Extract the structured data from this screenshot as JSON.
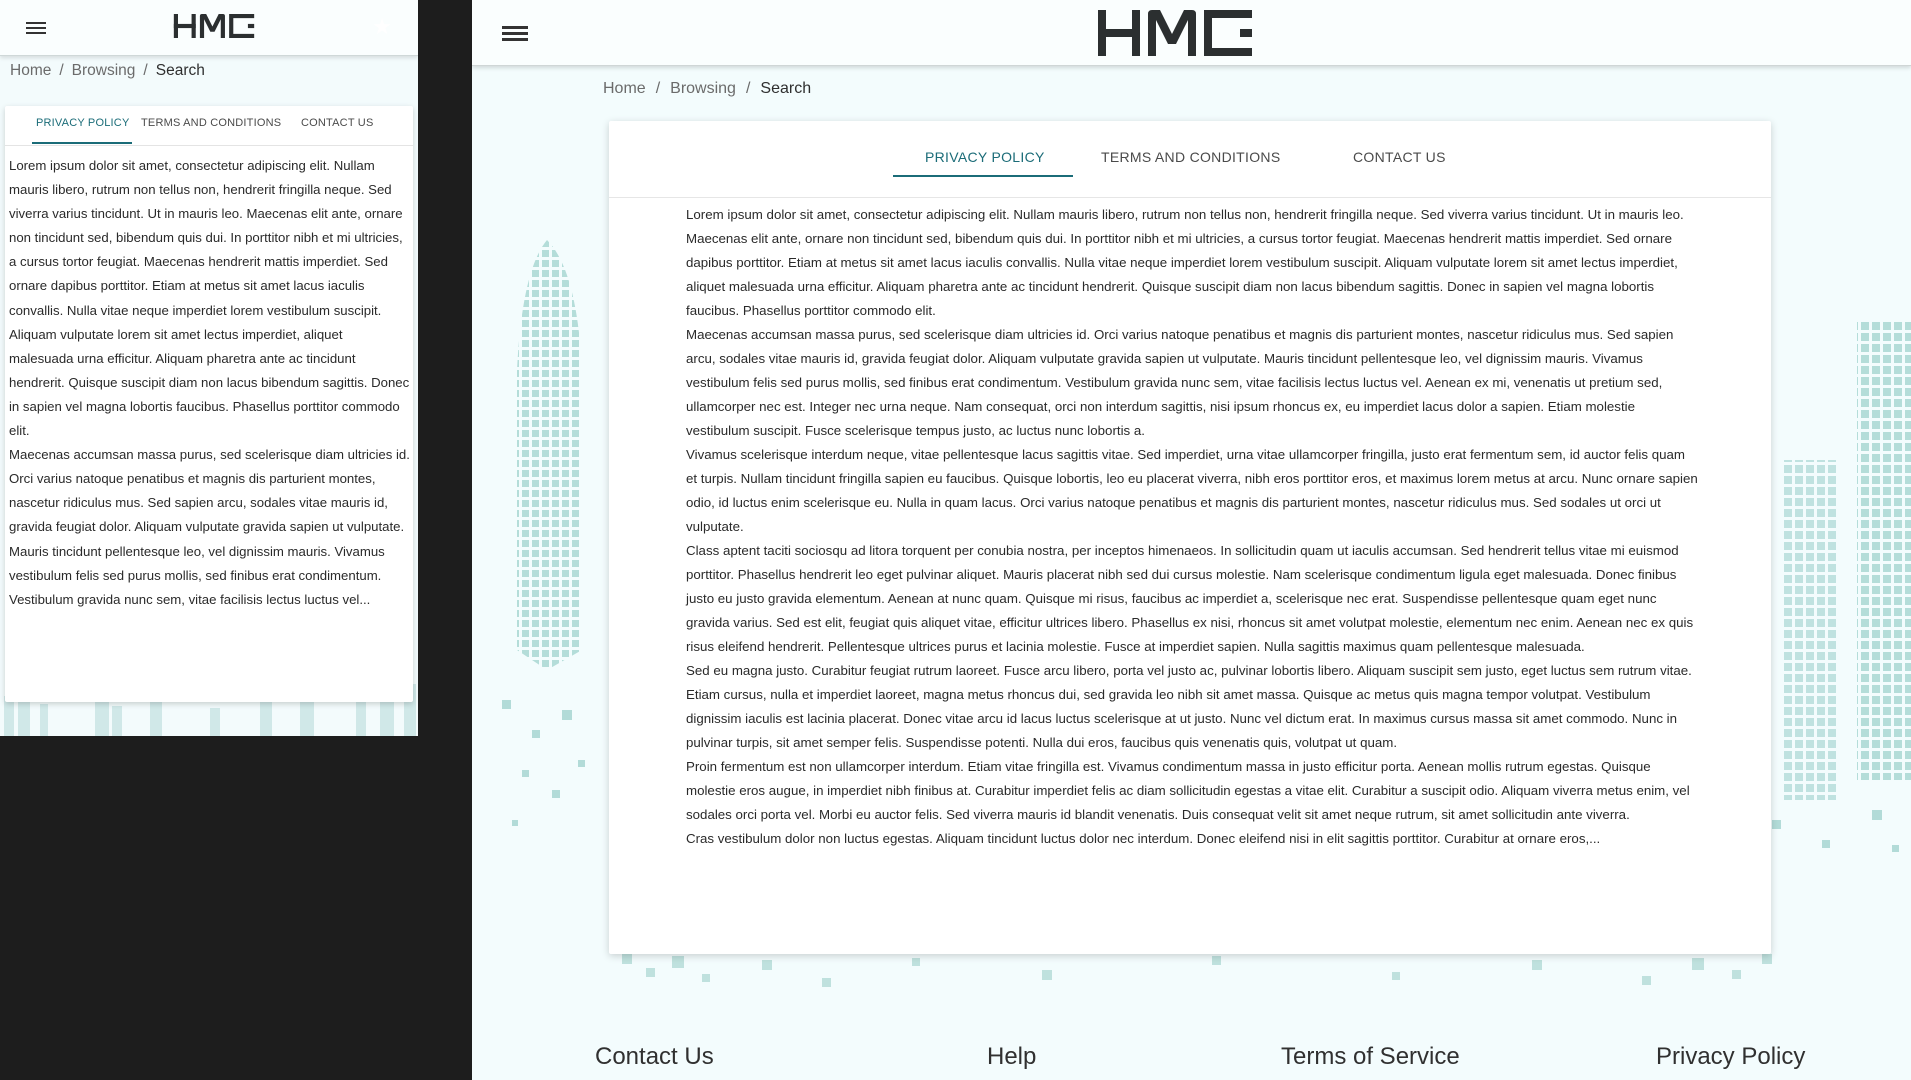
{
  "mobile": {
    "logo_text": "HME",
    "breadcrumb": {
      "home": "Home",
      "browsing": "Browsing",
      "current": "Search",
      "sep": "/"
    },
    "tabs": [
      "PRIVACY POLICY",
      "TERMS AND CONDITIONS",
      "CONTACT US"
    ],
    "paragraphs": [
      "Lorem ipsum dolor sit amet, consectetur adipiscing elit. Nullam mauris libero, rutrum non tellus non, hendrerit fringilla neque. Sed viverra varius tincidunt. Ut in mauris leo. Maecenas elit ante, ornare non tincidunt sed, bibendum quis dui. In porttitor nibh et mi ultricies, a cursus tortor feugiat. Maecenas hendrerit mattis imperdiet. Sed ornare dapibus porttitor. Etiam at metus sit amet lacus iaculis convallis. Nulla vitae neque imperdiet lorem vestibulum suscipit. Aliquam vulputate lorem sit amet lectus imperdiet, aliquet malesuada urna efficitur. Aliquam pharetra ante ac tincidunt hendrerit. Quisque suscipit diam non lacus bibendum sagittis. Donec in sapien vel magna lobortis faucibus. Phasellus porttitor commodo elit.",
      "Maecenas accumsan massa purus, sed scelerisque diam ultricies id. Orci varius natoque penatibus et magnis dis parturient montes, nascetur ridiculus mus. Sed sapien arcu, sodales vitae mauris id, gravida feugiat dolor. Aliquam vulputate gravida sapien ut vulputate. Mauris tincidunt pellentesque leo, vel dignissim mauris. Vivamus vestibulum felis sed purus mollis, sed finibus erat condimentum.",
      "Vestibulum gravida nunc sem, vitae facilisis lectus luctus vel..."
    ]
  },
  "desktop": {
    "logo_text": "HME",
    "breadcrumb": {
      "home": "Home",
      "browsing": "Browsing",
      "current": "Search",
      "sep": "/"
    },
    "tabs": [
      "PRIVACY POLICY",
      "TERMS AND CONDITIONS",
      "CONTACT US"
    ],
    "paragraphs": [
      "Lorem ipsum dolor sit amet, consectetur adipiscing elit. Nullam mauris libero, rutrum non tellus non, hendrerit fringilla neque. Sed viverra varius tincidunt. Ut in mauris leo. Maecenas elit ante, ornare non tincidunt sed, bibendum quis dui. In porttitor nibh et mi ultricies, a cursus tortor feugiat. Maecenas hendrerit mattis imperdiet. Sed ornare dapibus porttitor. Etiam at metus sit amet lacus iaculis convallis. Nulla vitae neque imperdiet lorem vestibulum suscipit. Aliquam vulputate lorem sit amet lectus imperdiet, aliquet malesuada urna efficitur. Aliquam pharetra ante ac tincidunt hendrerit. Quisque suscipit diam non lacus bibendum sagittis. Donec in sapien vel magna lobortis faucibus. Phasellus porttitor commodo elit.",
      "Maecenas accumsan massa purus, sed scelerisque diam ultricies id. Orci varius natoque penatibus et magnis dis parturient montes, nascetur ridiculus mus. Sed sapien arcu, sodales vitae mauris id, gravida feugiat dolor. Aliquam vulputate gravida sapien ut vulputate. Mauris tincidunt pellentesque leo, vel dignissim mauris. Vivamus vestibulum felis sed purus mollis, sed finibus erat condimentum. Vestibulum gravida nunc sem, vitae facilisis lectus luctus vel. Aenean ex mi, venenatis ut pretium sed, ullamcorper nec est. Integer nec urna neque. Nam consequat, orci non interdum sagittis, nisi ipsum rhoncus ex, eu imperdiet lacus dolor a sapien. Etiam molestie vestibulum suscipit. Fusce scelerisque tempus justo, ac luctus nunc lobortis a.",
      "Vivamus scelerisque interdum neque, vitae pellentesque lacus sagittis vitae. Sed imperdiet, urna vitae ullamcorper fringilla, justo erat fermentum sem, id auctor felis quam et turpis. Nullam tincidunt fringilla sapien eu faucibus. Quisque lobortis, leo eu placerat viverra, nibh eros porttitor eros, et maximus lorem metus at arcu. Nunc ornare sapien odio, id luctus enim scelerisque eu. Nulla in quam lacus. Orci varius natoque penatibus et magnis dis parturient montes, nascetur ridiculus mus. Sed sodales ut orci ut vulputate.",
      "Class aptent taciti sociosqu ad litora torquent per conubia nostra, per inceptos himenaeos. In sollicitudin quam ut iaculis accumsan. Sed hendrerit tellus vitae mi euismod porttitor. Phasellus hendrerit leo eget pulvinar aliquet. Mauris placerat nibh sed dui cursus molestie. Nam scelerisque condimentum ligula eget malesuada. Donec finibus justo eu justo gravida elementum. Aenean at nunc quam. Quisque mi risus, faucibus ac imperdiet a, scelerisque nec erat. Suspendisse pellentesque quam eget nunc gravida varius. Sed est elit, feugiat quis aliquet vitae, efficitur ultrices libero. Phasellus ex nisi, rhoncus sit amet volutpat molestie, elementum nec enim. Aenean nec ex quis risus eleifend hendrerit. Pellentesque ultrices purus et lacinia molestie. Fusce at imperdiet sapien. Nulla sagittis maximus quam pellentesque malesuada.",
      "Sed eu magna justo. Curabitur feugiat rutrum laoreet. Fusce arcu libero, porta vel justo ac, pulvinar lobortis libero. Aliquam suscipit sem justo, eget luctus sem rutrum vitae. Etiam cursus, nulla et imperdiet laoreet, magna metus rhoncus dui, sed gravida leo nibh sit amet massa. Quisque ac metus quis magna tempor volutpat. Vestibulum dignissim iaculis est lacinia placerat. Donec vitae arcu id lacus luctus scelerisque at ut justo. Nunc vel dictum erat. In maximus cursus massa sit amet commodo. Nunc in pulvinar turpis, sit amet semper felis. Suspendisse potenti. Nulla dui eros, faucibus quis venenatis quis, volutpat ut quam.",
      "Proin fermentum est non ullamcorper interdum. Etiam vitae fringilla est. Vivamus condimentum massa in justo efficitur porta. Aenean mollis rutrum egestas. Quisque molestie eros augue, in imperdiet nibh finibus at. Curabitur imperdiet felis ac diam sollicitudin egestas a vitae elit. Curabitur a suscipit odio. Aliquam viverra metus enim, vel sodales orci porta vel. Morbi eu auctor felis. Sed viverra mauris id blandit venenatis. Duis consequat velit sit amet neque rutrum, sit amet sollicitudin ante viverra.",
      "Cras vestibulum dolor non luctus egestas. Aliquam tincidunt luctus dolor nec interdum. Donec eleifend nisi in elit sagittis porttitor. Curabitur at ornare eros,..."
    ],
    "footer": [
      "Contact Us",
      "Help",
      "Terms of Service",
      "Privacy Policy"
    ]
  },
  "icons": {
    "menu": "hamburger-menu-icon",
    "favorite": "star-icon",
    "logo": "hme-logo"
  },
  "colors": {
    "accent": "#1b6c78",
    "page_bg": "#f3fcfd",
    "skyline": "#a6d3d0",
    "outer_bg": "#1d1d1d"
  }
}
